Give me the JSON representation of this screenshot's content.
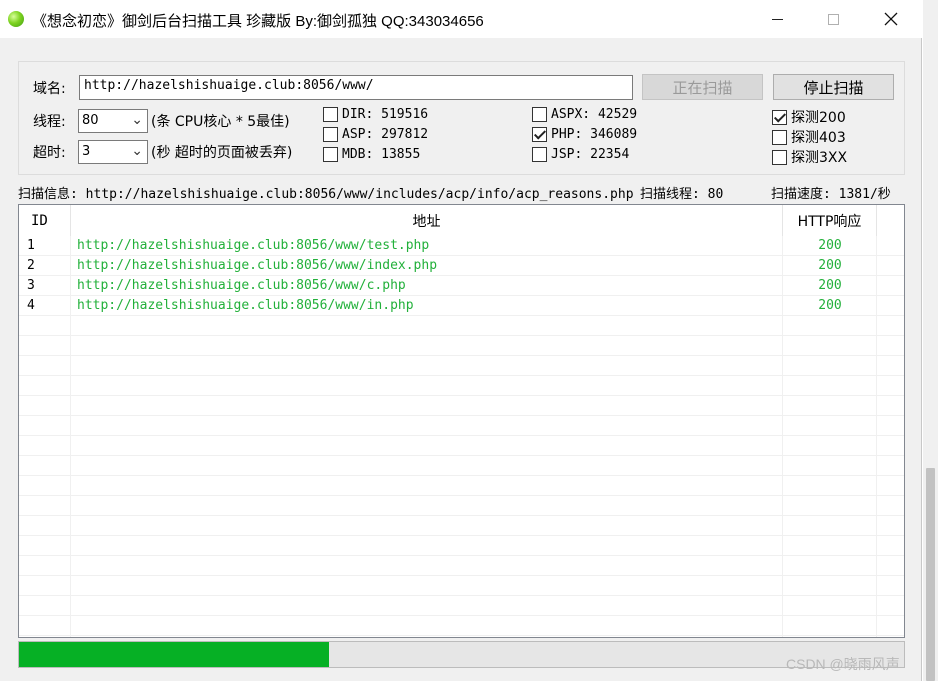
{
  "window": {
    "title": "《想念初恋》御剑后台扫描工具 珍藏版 By:御剑孤独 QQ:343034656",
    "minimize_icon": "minimize-icon",
    "maximize_icon": "maximize-icon",
    "close_icon": "close-icon"
  },
  "settings": {
    "domain_label": "域名:",
    "domain_value": "http://hazelshishuaige.club:8056/www/",
    "scanning_button": "正在扫描",
    "stop_button": "停止扫描",
    "threads_label": "线程:",
    "threads_value": "80",
    "threads_hint": "(条 CPU核心 * 5最佳)",
    "timeout_label": "超时:",
    "timeout_value": "3",
    "timeout_hint": "(秒 超时的页面被丢弃)",
    "dictionaries": [
      {
        "label": "DIR: 519516",
        "checked": false
      },
      {
        "label": "ASP: 297812",
        "checked": false
      },
      {
        "label": "MDB: 13855",
        "checked": false
      },
      {
        "label": "ASPX: 42529",
        "checked": false
      },
      {
        "label": "PHP: 346089",
        "checked": true
      },
      {
        "label": "JSP: 22354",
        "checked": false
      }
    ],
    "probes": [
      {
        "label": "探测200",
        "checked": true
      },
      {
        "label": "探测403",
        "checked": false
      },
      {
        "label": "探测3XX",
        "checked": false
      }
    ]
  },
  "status": {
    "scan_info": "扫描信息: http://hazelshishuaige.club:8056/www/includes/acp/info/acp_reasons.php",
    "scan_threads": "扫描线程: 80",
    "scan_speed": "扫描速度: 1381/秒"
  },
  "table": {
    "columns": [
      "ID",
      "地址",
      "HTTP响应"
    ],
    "rows": [
      {
        "id": "1",
        "url": "http://hazelshishuaige.club:8056/www/test.php",
        "code": "200"
      },
      {
        "id": "2",
        "url": "http://hazelshishuaige.club:8056/www/index.php",
        "code": "200"
      },
      {
        "id": "3",
        "url": "http://hazelshishuaige.club:8056/www/c.php",
        "code": "200"
      },
      {
        "id": "4",
        "url": "http://hazelshishuaige.club:8056/www/in.php",
        "code": "200"
      }
    ]
  },
  "progress": {
    "fraction": 0.35
  },
  "colors": {
    "accent_green": "#06b025",
    "found_text": "#22b03a"
  },
  "watermark": "CSDN @晓雨风声"
}
